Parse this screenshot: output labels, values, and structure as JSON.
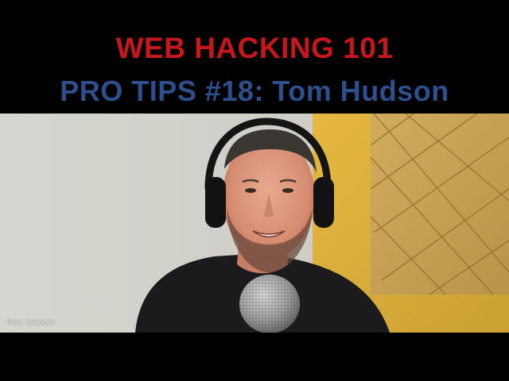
{
  "header": {
    "title": "WEB HACKING 101",
    "subtitle": "PRO TIPS #18: Tom Hudson"
  },
  "video": {
    "participant_name": "Peter Yaworski"
  },
  "colors": {
    "title_red": "#c8161d",
    "subtitle_blue": "#2d4f8e",
    "background": "#000000",
    "wall_gray": "#d8d8d2",
    "wall_yellow": "#e0b33c",
    "panel_tan": "#c8a356",
    "shirt": "#1a1a1c"
  },
  "icons": {
    "microphone": "microphone-icon",
    "headphones": "headphones-icon"
  }
}
